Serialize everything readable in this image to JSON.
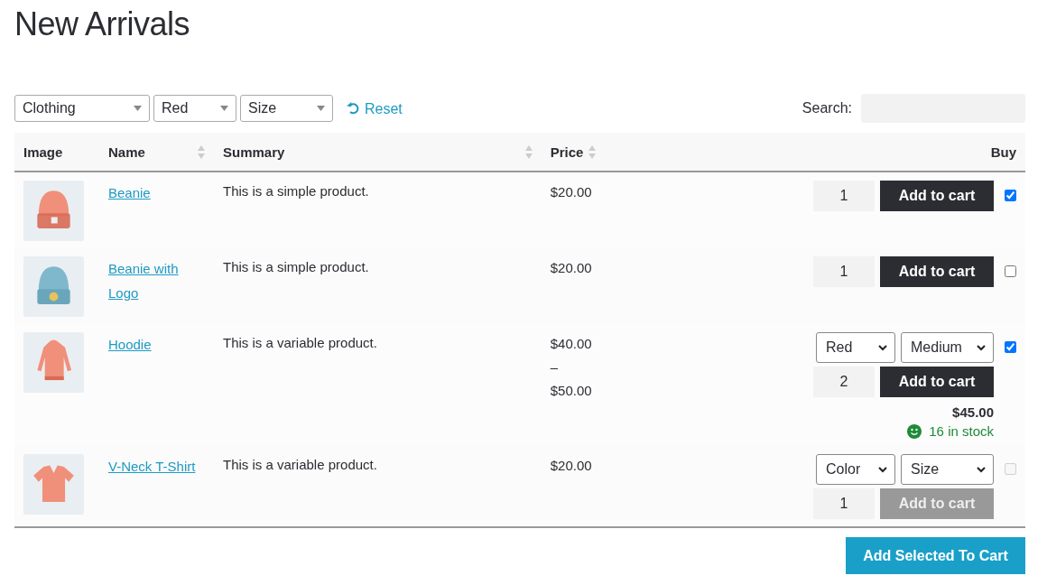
{
  "title": "New Arrivals",
  "filters": [
    {
      "label": "Clothing"
    },
    {
      "label": "Red"
    },
    {
      "label": "Size"
    }
  ],
  "reset": {
    "label": "Reset"
  },
  "search": {
    "label": "Search:"
  },
  "table": {
    "columns": [
      {
        "label": "Image",
        "sortable": false
      },
      {
        "label": "Name",
        "sortable": true
      },
      {
        "label": "Summary",
        "sortable": true
      },
      {
        "label": "Price",
        "sortable": true
      },
      {
        "label": "Buy",
        "sortable": false
      }
    ],
    "rows": [
      {
        "kind": "beanie",
        "name": "Beanie",
        "summary": "This is a simple product.",
        "price": "$20.00",
        "options": [],
        "quantity": "1",
        "add_button": {
          "label": "Add to cart",
          "disabled": false
        },
        "selected": true,
        "disabled": false
      },
      {
        "kind": "beanie-logo",
        "name": "Beanie with Logo",
        "summary": "This is a simple product.",
        "price": "$20.00",
        "options": [],
        "quantity": "1",
        "add_button": {
          "label": "Add to cart",
          "disabled": false
        },
        "selected": false,
        "disabled": false
      },
      {
        "kind": "hoodie",
        "name": "Hoodie",
        "summary": "This is a variable product.",
        "price": "$40.00 – $50.00",
        "options": [
          "Red",
          "Medium"
        ],
        "quantity": "2",
        "add_button": {
          "label": "Add to cart",
          "disabled": false
        },
        "variation_price": "$45.00",
        "stock": "16 in stock",
        "selected": true,
        "disabled": false
      },
      {
        "kind": "tshirt",
        "name": "V-Neck T-Shirt",
        "summary": "This is a variable product.",
        "price": "$20.00",
        "options": [
          "Color",
          "Size"
        ],
        "quantity": "1",
        "add_button": {
          "label": "Add to cart",
          "disabled": true
        },
        "selected": false,
        "disabled": true
      }
    ]
  },
  "add_selected": {
    "label": "Add Selected To Cart"
  }
}
